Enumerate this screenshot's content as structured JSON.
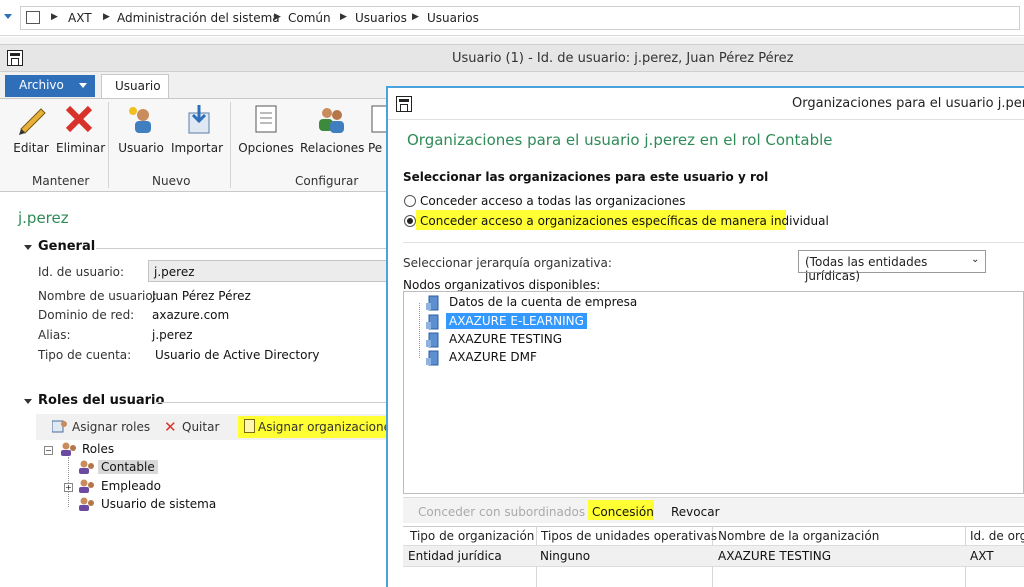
{
  "breadcrumb": [
    "AXT",
    "Administración del sistema",
    "Común",
    "Usuarios",
    "Usuarios"
  ],
  "window_title": "Usuario (1) - Id. de usuario: j.perez, Juan Pérez Pérez",
  "ribbon": {
    "tabs": [
      "Archivo",
      "Usuario"
    ],
    "buttons": [
      "Editar",
      "Eliminar",
      "Usuario",
      "Importar",
      "Opciones",
      "Relaciones",
      "Pe"
    ],
    "groups": [
      "Mantener",
      "Nuevo",
      "Configurar"
    ]
  },
  "user_heading": "j.perez",
  "general": {
    "title": "General",
    "fields": [
      {
        "label": "Id. de usuario:",
        "value": "j.perez"
      },
      {
        "label": "Nombre de usuario:",
        "value": "Juan Pérez Pérez"
      },
      {
        "label": "Dominio de red:",
        "value": "axazure.com"
      },
      {
        "label": "Alias:",
        "value": "j.perez"
      },
      {
        "label": "Tipo de cuenta:",
        "value": "Usuario de Active Directory"
      }
    ]
  },
  "roles": {
    "title": "Roles del usuario",
    "toolbar": [
      "Asignar roles",
      "Quitar",
      "Asignar organizaciones"
    ],
    "tree_root": "Roles",
    "tree_items": [
      "Contable",
      "Empleado",
      "Usuario de sistema"
    ]
  },
  "modal": {
    "title": "Organizaciones para el usuario j.pere",
    "heading": "Organizaciones para el usuario j.perez en el rol Contable",
    "section": "Seleccionar las organizaciones para este usuario y rol",
    "radio_all": "Conceder acceso a todas las organizaciones",
    "radio_specific": "Conceder acceso a organizaciones específicas de manera individual",
    "hierarchy_label": "Seleccionar jerarquía organizativa:",
    "hierarchy_value": "(Todas las entidades jurídicas)",
    "nodes_label": "Nodos organizativos disponibles:",
    "nodes": [
      "Datos de la cuenta de empresa",
      "AXAZURE E-LEARNING",
      "AXAZURE TESTING",
      "AXAZURE DMF"
    ],
    "actions": [
      "Conceder con subordinados",
      "Concesión",
      "Revocar"
    ],
    "grid_headers": [
      "Tipo de organización",
      "Tipos de unidades operativas",
      "Nombre de la organización",
      "Id. de orga"
    ],
    "grid_row": [
      "Entidad jurídica",
      "Ninguno",
      "AXAZURE TESTING",
      "AXT"
    ]
  },
  "colors": {
    "accent_blue": "#2f6fba",
    "green_heading": "#2e8b57",
    "highlight": "#ffff33",
    "modal_border": "#4aa3df",
    "node_selected": "#3399ff"
  }
}
